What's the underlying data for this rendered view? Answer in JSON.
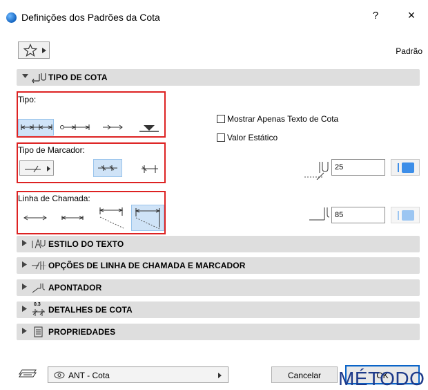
{
  "window": {
    "title": "Definições dos Padrões da Cota",
    "help": "?",
    "close": "×"
  },
  "header": {
    "favorites_label": "Padrão"
  },
  "sections": {
    "tipo_de_cota": "TIPO DE COTA",
    "estilo_do_texto": "ESTILO DO TEXTO",
    "opcoes_linha_marcador": "OPÇÕES DE LINHA DE CHAMADA E MARCADOR",
    "apontador": "APONTADOR",
    "detalhes_de_cota": "DETALHES DE COTA",
    "propriedades": "PROPRIEDADES"
  },
  "tipo": {
    "label": "Tipo:",
    "show_text_only": "Mostrar Apenas Texto de Cota",
    "static_value": "Valor Estático"
  },
  "marcador": {
    "label": "Tipo de Marcador:",
    "size_value": "25"
  },
  "chamada": {
    "label": "Linha de Chamada:",
    "length_value": "85"
  },
  "detalhes_icon_text": "0.3",
  "footer": {
    "layer": "ANT - Cota",
    "cancel": "Cancelar",
    "ok": "OK"
  },
  "overlay_text": "MÉTODO I",
  "colors": {
    "accent": "#3d8ee8",
    "selection": "#cfe3f7",
    "highlight_box": "#d22222"
  }
}
